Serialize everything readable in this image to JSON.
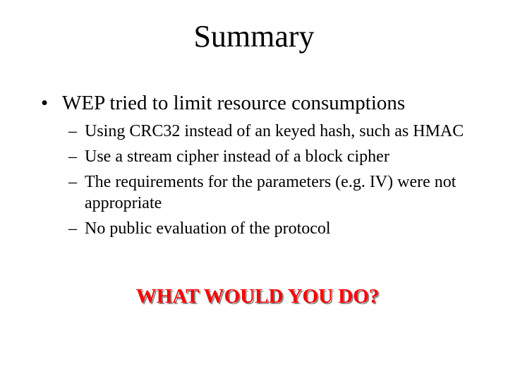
{
  "slide": {
    "title": "Summary",
    "bullet_marker": "•",
    "bullet": "WEP tried to limit resource consumptions",
    "sub_marker": "–",
    "subitems": [
      "Using CRC32 instead of an keyed hash, such as HMAC",
      "Use a stream cipher instead of a block cipher",
      "The requirements for the parameters (e.g. IV) were not appropriate",
      "No public evaluation of the protocol"
    ],
    "callout": "WHAT WOULD YOU DO?",
    "colors": {
      "text": "#000000",
      "callout": "#ff0000",
      "callout_shadow": "#8a8a8a",
      "background": "#ffffff"
    }
  }
}
